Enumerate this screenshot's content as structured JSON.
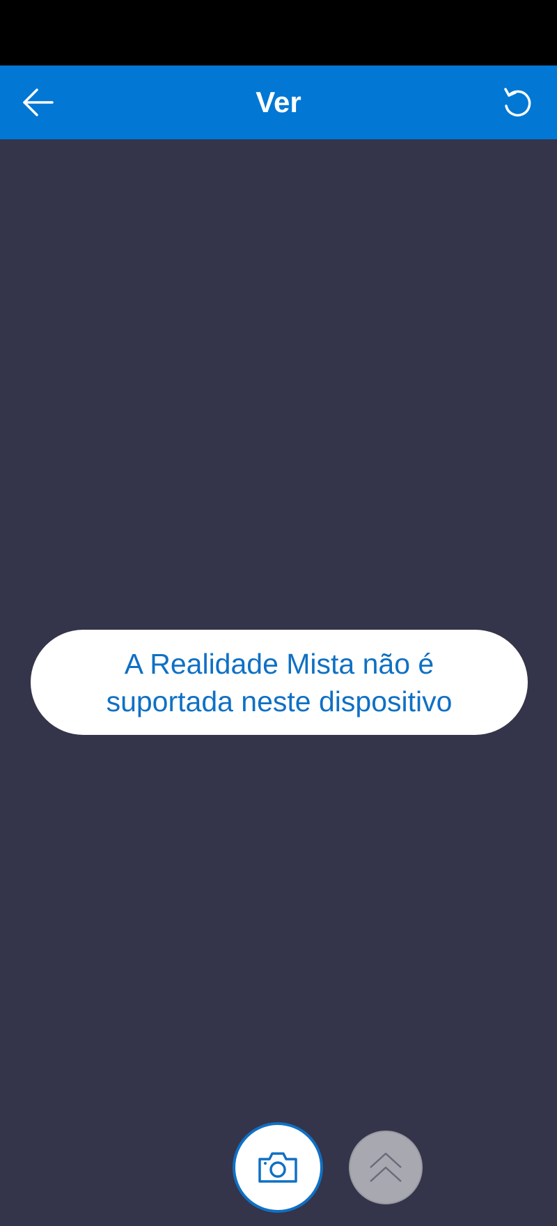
{
  "app_bar": {
    "title": "Ver",
    "back_icon": "arrow-left-icon",
    "reset_icon": "rotate-ccw-icon",
    "background": "#0277d4"
  },
  "toast": {
    "message": "A Realidade Mista não é suportada neste dispositivo",
    "text_color": "#0f70c4"
  },
  "controls": {
    "camera_icon": "camera-icon",
    "expand_icon": "chevron-double-up-icon"
  },
  "colors": {
    "screen_background": "#34344a",
    "status_bar": "#000000"
  }
}
